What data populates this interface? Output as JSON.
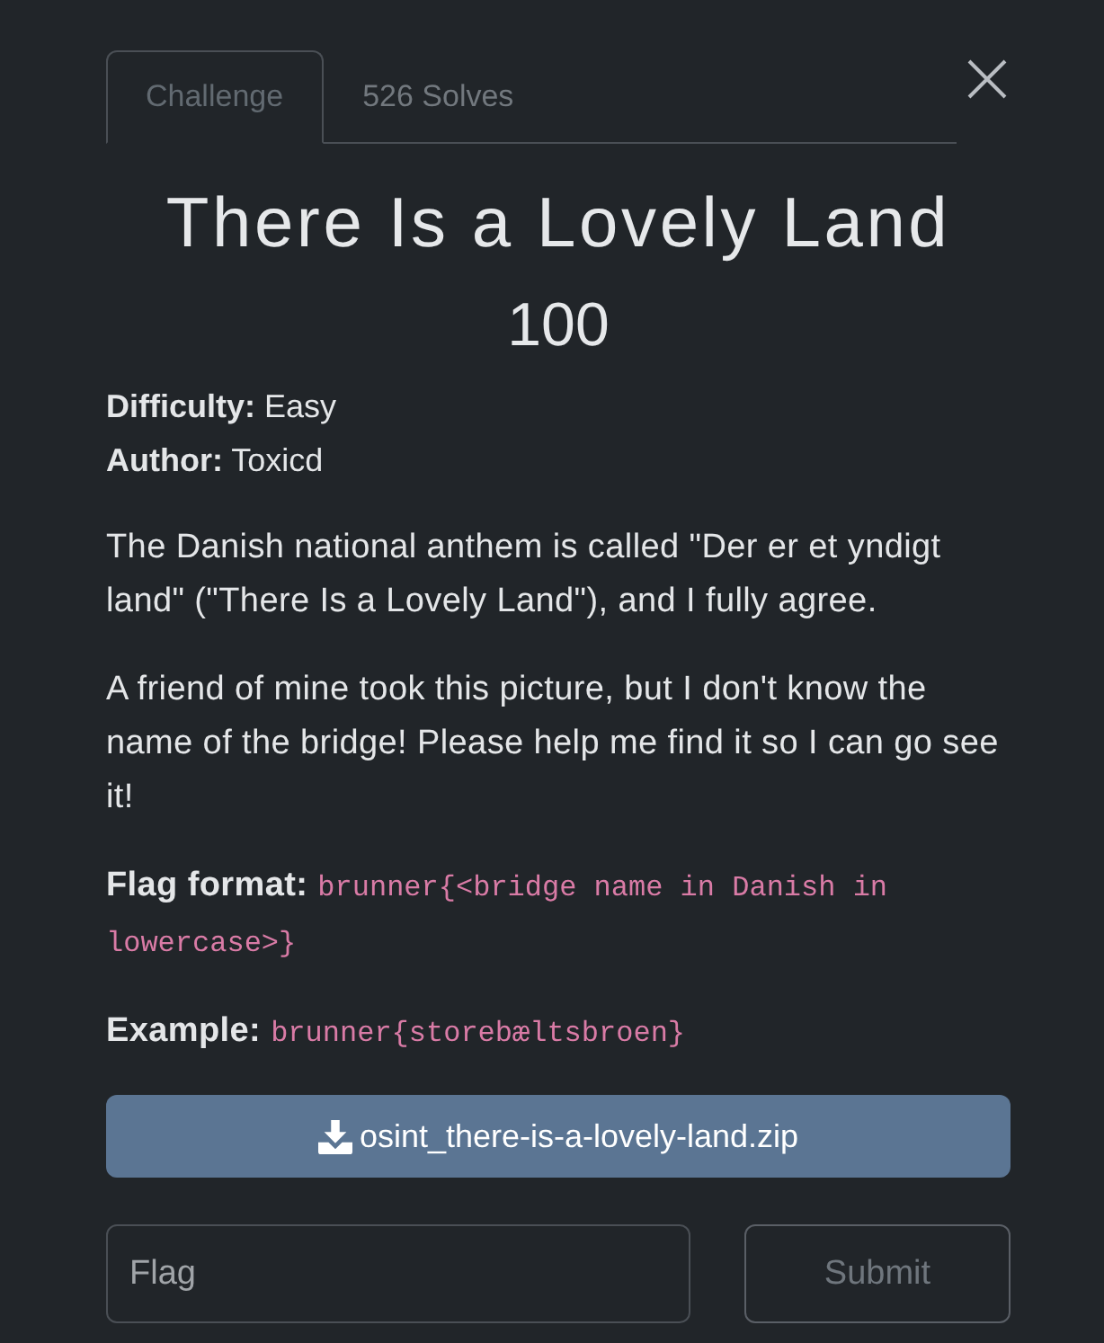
{
  "tabs": [
    {
      "label": "Challenge",
      "selected": true
    },
    {
      "label": "526 Solves",
      "selected": false
    }
  ],
  "challenge": {
    "title": "There Is a Lovely Land",
    "points": "100",
    "meta": [
      "**Difficulty:** Easy",
      "**Author:** Toxicd"
    ],
    "description": [
      "The Danish national anthem is called \"Der er et yndigt land\" (\"There Is a Lovely Land\"), and I fully agree.",
      "A friend of mine took this picture, but I don't know the name of the bridge! Please help me find it so I can go see it!"
    ],
    "format_lines": [
      {
        "label": "Flag format:",
        "code": "brunner{<bridge name in Danish in lowercase>}"
      },
      {
        "label": "Example:",
        "code": "brunner{storebæltsbroen}"
      }
    ]
  },
  "download": {
    "label": "osint_there-is-a-lovely-land.zip"
  },
  "flag_input": {
    "placeholder": "Flag"
  },
  "submit": {
    "label": "Submit"
  }
}
